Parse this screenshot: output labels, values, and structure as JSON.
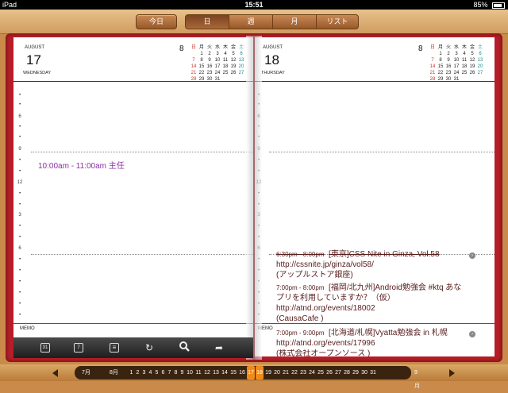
{
  "status": {
    "device": "iPad",
    "time": "15:51",
    "battery": "85%",
    "battery_level": 0.85
  },
  "topbar": {
    "today_label": "今日",
    "segments": [
      {
        "label": "日",
        "active": true
      },
      {
        "label": "週",
        "active": false
      },
      {
        "label": "月",
        "active": false
      },
      {
        "label": "リスト",
        "active": false
      }
    ]
  },
  "left_page": {
    "month": "AUGUST",
    "day": "17",
    "weekday": "WEDNESDAY",
    "hours": [
      "6",
      "9",
      "12",
      "3",
      "6"
    ],
    "event": "10:00am - 11:00am  主任",
    "memo": "MEMO"
  },
  "right_page": {
    "month": "AUGUST",
    "day": "18",
    "weekday": "THURSDAY",
    "hours": [
      "6",
      "9",
      "12",
      "3",
      "6"
    ],
    "memo": "MEMO",
    "events": [
      {
        "time": "6:30pm - 8:00pm",
        "title": "[東京]CSS Nite in Ginza, Vol.58",
        "line2": "http://cssnite.jp/ginza/vol58/",
        "line3": "(アップルストア銀座)"
      },
      {
        "time": "7:00pm - 8:00pm",
        "title": "[福岡/北九州]Android勉強会 #ktq あな",
        "line2": "プリを利用していますか？（仮）",
        "line3": "http://atnd.org/events/18002",
        "line4": "(CausaCafe )"
      },
      {
        "time": "7:00pm - 9:00pm",
        "title": "[北海道/札幌]Vyatta勉強会 in 札幌",
        "line2": "http://atnd.org/events/17996",
        "line3": "(株式会社オープンソース )"
      }
    ]
  },
  "mini_calendar": {
    "month_number": "8",
    "headers": [
      "日",
      "月",
      "火",
      "水",
      "木",
      "金",
      "土"
    ],
    "weeks": [
      [
        "",
        "1",
        "2",
        "3",
        "4",
        "5",
        "6"
      ],
      [
        "7",
        "8",
        "9",
        "10",
        "11",
        "12",
        "13"
      ],
      [
        "14",
        "15",
        "16",
        "17",
        "18",
        "19",
        "20"
      ],
      [
        "21",
        "22",
        "23",
        "24",
        "25",
        "26",
        "27"
      ],
      [
        "28",
        "29",
        "30",
        "31",
        "",
        "",
        ""
      ]
    ]
  },
  "toolbar": {
    "icons": [
      "calendar-31-icon",
      "calendar-7-icon",
      "list-icon",
      "refresh-icon",
      "search-icon",
      "share-icon"
    ],
    "cal31": "31",
    "cal7": "7"
  },
  "strip": {
    "prev_month": "7月",
    "current_month": "8月",
    "next_month": "9月",
    "days": [
      "1",
      "2",
      "3",
      "4",
      "5",
      "6",
      "7",
      "8",
      "9",
      "10",
      "11",
      "12",
      "13",
      "14",
      "15",
      "16",
      "17",
      "18",
      "19",
      "20",
      "21",
      "22",
      "23",
      "24",
      "25",
      "26",
      "27",
      "28",
      "29",
      "30",
      "31"
    ],
    "active_days": [
      "17",
      "18"
    ]
  },
  "colors": {
    "cover": "#b61e28",
    "wood": "#c98a4a",
    "event_purple": "#8a2fa0",
    "event_brown": "#5a2020",
    "sunday": "#c0392b",
    "saturday": "#1f8c8c",
    "active_day": "#f08a1a"
  }
}
